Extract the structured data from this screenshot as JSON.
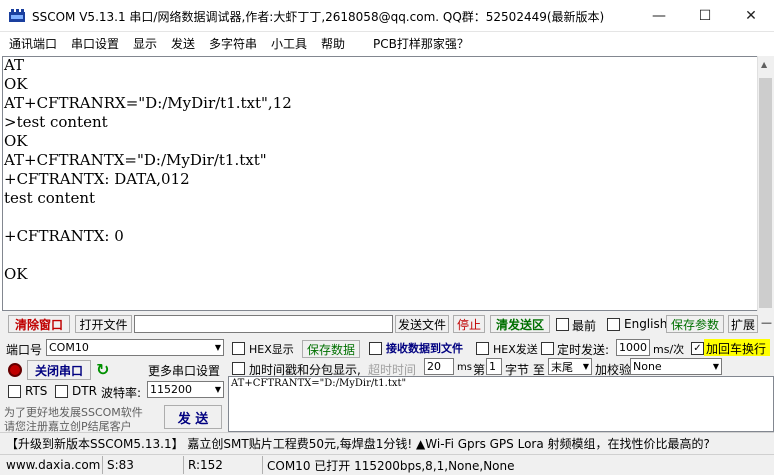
{
  "window": {
    "title": "SSCOM V5.13.1 串口/网络数据调试器,作者:大虾丁丁,2618058@qq.com. QQ群：52502449(最新版本)",
    "icon": "serial-port-icon",
    "minimize": "—",
    "maximize": "☐",
    "close": "✕"
  },
  "menu": [
    "通讯端口",
    "串口设置",
    "显示",
    "发送",
    "多字符串",
    "小工具",
    "帮助",
    "PCB打样那家强？"
  ],
  "receive_lines": [
    "AT",
    "OK",
    "AT+CFTRANRX=\"D:/MyDir/t1.txt\",12",
    ">test content",
    "OK",
    "AT+CFTRANTX=\"D:/MyDir/t1.txt\"",
    "+CFTRANTX: DATA,012",
    "test content",
    "",
    "+CFTRANTX: 0",
    "",
    "OK"
  ],
  "row1": {
    "clear_window": "清除窗口",
    "open_file": "打开文件",
    "file_path": "",
    "send_file": "发送文件",
    "stop": "停止",
    "clear_send": "清发送区",
    "front": "最前",
    "english": "English",
    "save_params": "保存参数",
    "expand": "扩展",
    "collapse": "—"
  },
  "port": {
    "port_label": "端口号",
    "port_value": "COM10",
    "close_port": "关闭串口",
    "more_settings": "更多串口设置",
    "rts": "RTS",
    "dtr": "DTR",
    "baud_label": "波特率:",
    "baud_value": "115200",
    "promo_text_1": "为了更好地发展SSCOM软件",
    "promo_text_2": "请您注册嘉立创P结尾客户",
    "send": "发 送"
  },
  "options": {
    "hex_display": "HEX显示",
    "save_data": "保存数据",
    "recv_to_file": "接收数据到文件",
    "hex_send": "HEX发送",
    "timed_send": "定时发送:",
    "interval": "1000",
    "interval_unit": "ms/次",
    "add_crlf": "加回车换行",
    "timestamp": "加时间戳和分包显示,",
    "timeout_label": "超时时间",
    "timeout_value": "20",
    "timeout_unit": "ms",
    "nth_label": "第",
    "nth_value": "1",
    "byte_label": "字节 至",
    "end_value": "末尾",
    "checksum_label": "加校验",
    "checksum_value": "None"
  },
  "send_text": "AT+CFTRANTX=\"D:/MyDir/t1.txt\"",
  "promo_bar": "【升级到新版本SSCOM5.13.1】     嘉立创SMT贴片工程费50元,每焊盘1分钱! ▲Wi-Fi Gprs GPS Lora 射频模组，在找性价比最高的?",
  "status": {
    "site": "www.daxia.com",
    "sent": "S:83",
    "recv": "R:152",
    "port_state": "COM10 已打开  115200bps,8,1,None,None"
  }
}
